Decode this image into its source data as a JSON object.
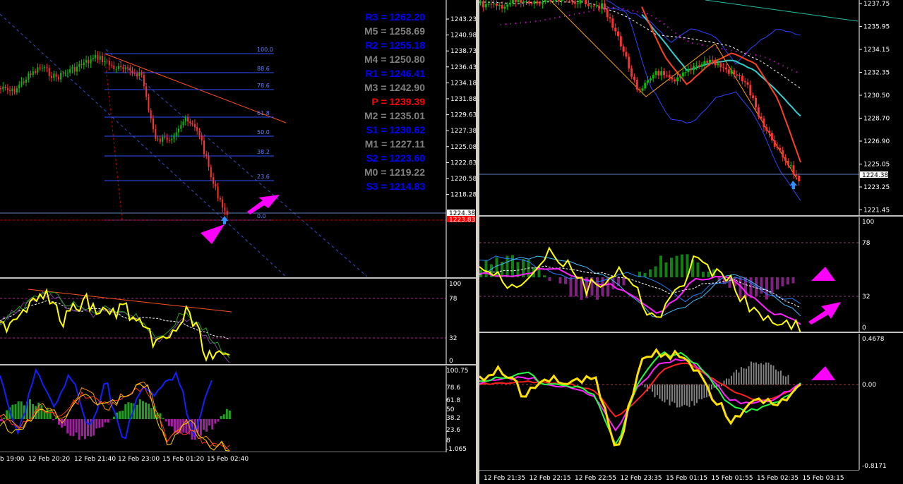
{
  "left_chart": {
    "price_scale": [
      "1243.23",
      "1240.98",
      "1238.73",
      "1236.43",
      "1234.18",
      "1231.88",
      "1229.63",
      "1227.38",
      "1225.08",
      "1222.83",
      "1220.58",
      "1218.28"
    ],
    "current_price": "1224.38",
    "current_price_red": "1223.83",
    "fib_levels": [
      "100.0",
      "88.6",
      "78.6",
      "61.8",
      "50.0",
      "38.2",
      "23.6",
      "0.0"
    ],
    "pivots": [
      {
        "label": "R3 = 1262.20",
        "color": "#0000ff"
      },
      {
        "label": "M5 = 1258.69",
        "color": "#808080"
      },
      {
        "label": "R2 = 1255.18",
        "color": "#0000ff"
      },
      {
        "label": "M4 = 1250.80",
        "color": "#808080"
      },
      {
        "label": "R1 = 1246.41",
        "color": "#0000ff"
      },
      {
        "label": "M3 = 1242.90",
        "color": "#808080"
      },
      {
        "label": "P   = 1239.39",
        "color": "#ff0000"
      },
      {
        "label": "M2 = 1235.01",
        "color": "#808080"
      },
      {
        "label": "S1 = 1230.62",
        "color": "#0000ff"
      },
      {
        "label": "M1 = 1227.11",
        "color": "#808080"
      },
      {
        "label": "S2 = 1223.60",
        "color": "#0000ff"
      },
      {
        "label": "M0 = 1219.22",
        "color": "#808080"
      },
      {
        "label": "S3 = 1214.83",
        "color": "#0000ff"
      }
    ],
    "osc1_scale": [
      "100",
      "78",
      "32",
      "0"
    ],
    "osc2_scale": [
      "100.75",
      "78.6",
      "61.8",
      "50",
      "38.2",
      "23.6",
      "8",
      "-1.065"
    ],
    "time_axis": [
      "b 19:00",
      "12 Feb 20:20",
      "12 Feb 21:40",
      "12 Feb 23:00",
      "15 Feb 01:20",
      "15 Feb 02:40"
    ]
  },
  "right_chart": {
    "price_scale": [
      "1237.75",
      "1235.95",
      "1234.15",
      "1232.35",
      "1230.50",
      "1228.70",
      "1226.90",
      "1225.05",
      "1223.25",
      "1221.45"
    ],
    "current_price": "1224.38",
    "osc1_scale": [
      "100",
      "78",
      "32",
      "0"
    ],
    "osc2_scale": [
      "0.4678",
      "0.00",
      "-0.8171"
    ],
    "time_axis": [
      "12 Feb 21:35",
      "12 Feb 22:15",
      "12 Feb 22:55",
      "12 Feb 23:35",
      "15 Feb 01:15",
      "15 Feb 01:55",
      "15 Feb 02:35",
      "15 Feb 03:15"
    ]
  },
  "colors": {
    "bull": "#00c000",
    "bear": "#ff3030",
    "arrow": "#ff00ff",
    "grid": "#2020a0",
    "fib": "#4060ff"
  }
}
